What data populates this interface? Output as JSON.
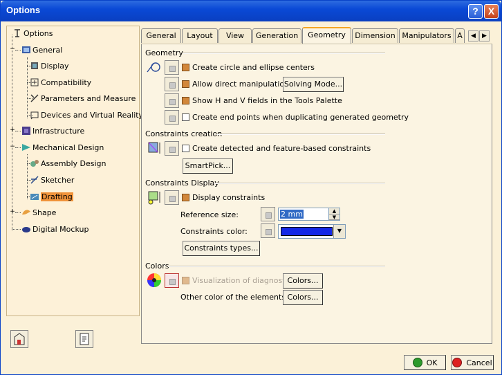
{
  "window": {
    "title": "Options",
    "help_label": "?",
    "close_label": "X"
  },
  "tree": [
    {
      "label": "Options"
    },
    {
      "label": "General"
    },
    {
      "label": "Display"
    },
    {
      "label": "Compatibility"
    },
    {
      "label": "Parameters and Measure"
    },
    {
      "label": "Devices and Virtual Reality"
    },
    {
      "label": "Infrastructure"
    },
    {
      "label": "Mechanical Design"
    },
    {
      "label": "Assembly Design"
    },
    {
      "label": "Sketcher"
    },
    {
      "label": "Drafting"
    },
    {
      "label": "Shape"
    },
    {
      "label": "Digital Mockup"
    }
  ],
  "tabs": [
    "General",
    "Layout",
    "View",
    "Generation",
    "Geometry",
    "Dimension",
    "Manipulators",
    "A"
  ],
  "active_tab": "Geometry",
  "geometry": {
    "title": "Geometry",
    "create_centers": "Create circle and ellipse centers",
    "allow_direct": "Allow direct manipulation",
    "solving_mode": "Solving Mode...",
    "show_hv": "Show H and V fields in the Tools Palette",
    "create_end_points": "Create end points when duplicating generated geometry"
  },
  "constraints_creation": {
    "title": "Constraints creation",
    "create_detected": "Create detected and feature-based constraints",
    "smartpick": "SmartPick..."
  },
  "constraints_display": {
    "title": "Constraints Display",
    "display_constraints": "Display constraints",
    "reference_size_label": "Reference size:",
    "reference_size_value": "2 mm",
    "color_label": "Constraints color:",
    "color_value": "#1428e6",
    "types_button": "Constraints types..."
  },
  "colors": {
    "title": "Colors",
    "visualization": "Visualization of diagnostic",
    "colors_button_1": "Colors...",
    "other_color": "Other color of the elements",
    "colors_button_2": "Colors..."
  },
  "footer": {
    "ok": "OK",
    "cancel": "Cancel"
  }
}
